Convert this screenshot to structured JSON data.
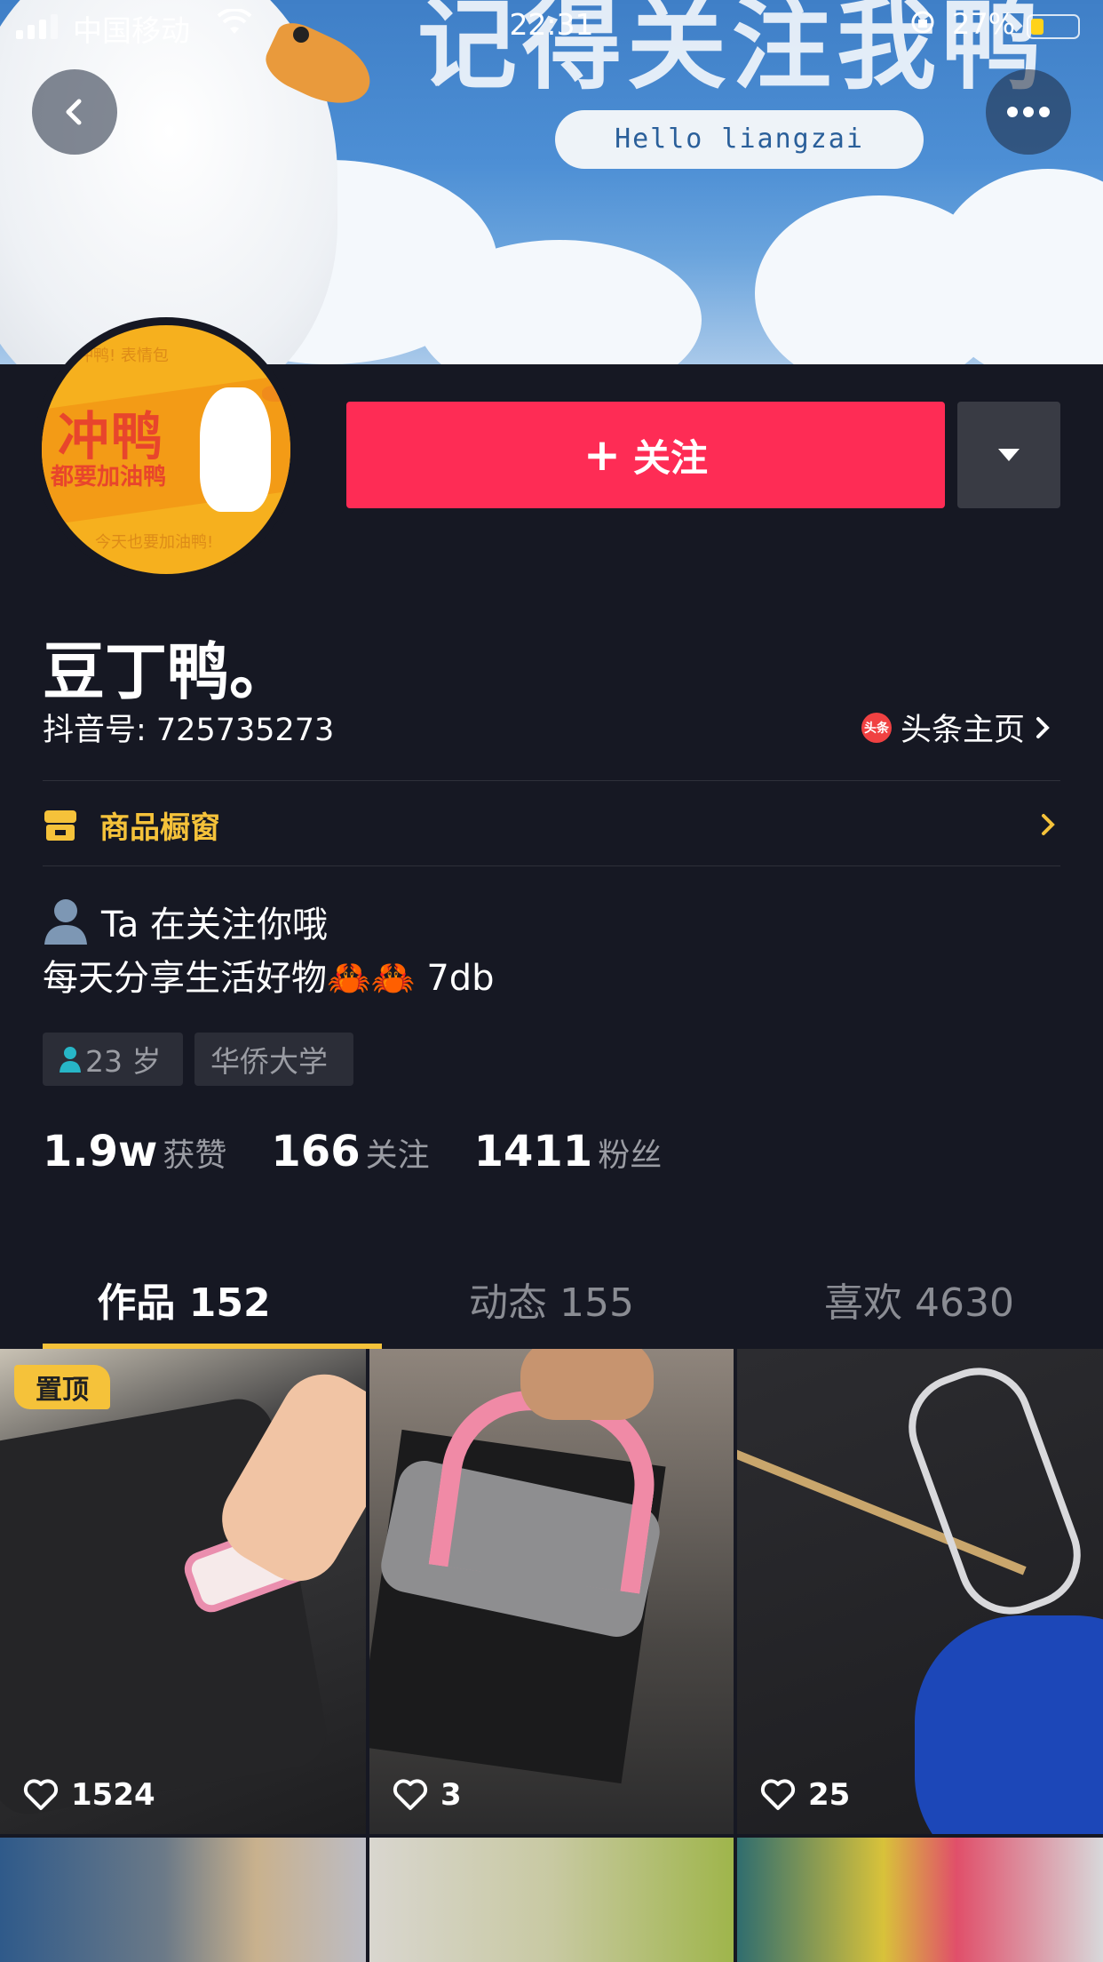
{
  "status_bar": {
    "carrier": "中国移动",
    "time": "22:31",
    "battery_percent": "27%"
  },
  "banner": {
    "big_text": "记得关注我鸭",
    "pill_text": "Hello liangzai"
  },
  "avatar": {
    "big_text": "冲鸭",
    "small_text": "都要加油鸭"
  },
  "actions": {
    "follow_plus": "+",
    "follow_label": "关注"
  },
  "profile": {
    "nickname": "豆丁鸭。",
    "douyin_id": "抖音号: 725735273",
    "toutiao_label": "头条主页",
    "toutiao_logo": "头条"
  },
  "shop": {
    "label": "商品橱窗"
  },
  "bio": {
    "line1": "Ta 在关注你哦",
    "line2": "每天分享生活好物🦀🦀 7db"
  },
  "tags": {
    "age": "23 岁",
    "school": "华侨大学"
  },
  "stats": [
    {
      "num": "1.9w",
      "label": "获赞"
    },
    {
      "num": "166",
      "label": "关注"
    },
    {
      "num": "1411",
      "label": "粉丝"
    }
  ],
  "tabs": [
    {
      "label": "作品 152",
      "active": true
    },
    {
      "label": "动态 155",
      "active": false
    },
    {
      "label": "喜欢 4630",
      "active": false
    }
  ],
  "videos": [
    {
      "likes": "1524",
      "pinned_label": "置顶"
    },
    {
      "likes": "3"
    },
    {
      "likes": "25"
    }
  ],
  "colors": {
    "background": "#161823",
    "follow": "#fe2c55",
    "accent": "#f5c23a"
  }
}
